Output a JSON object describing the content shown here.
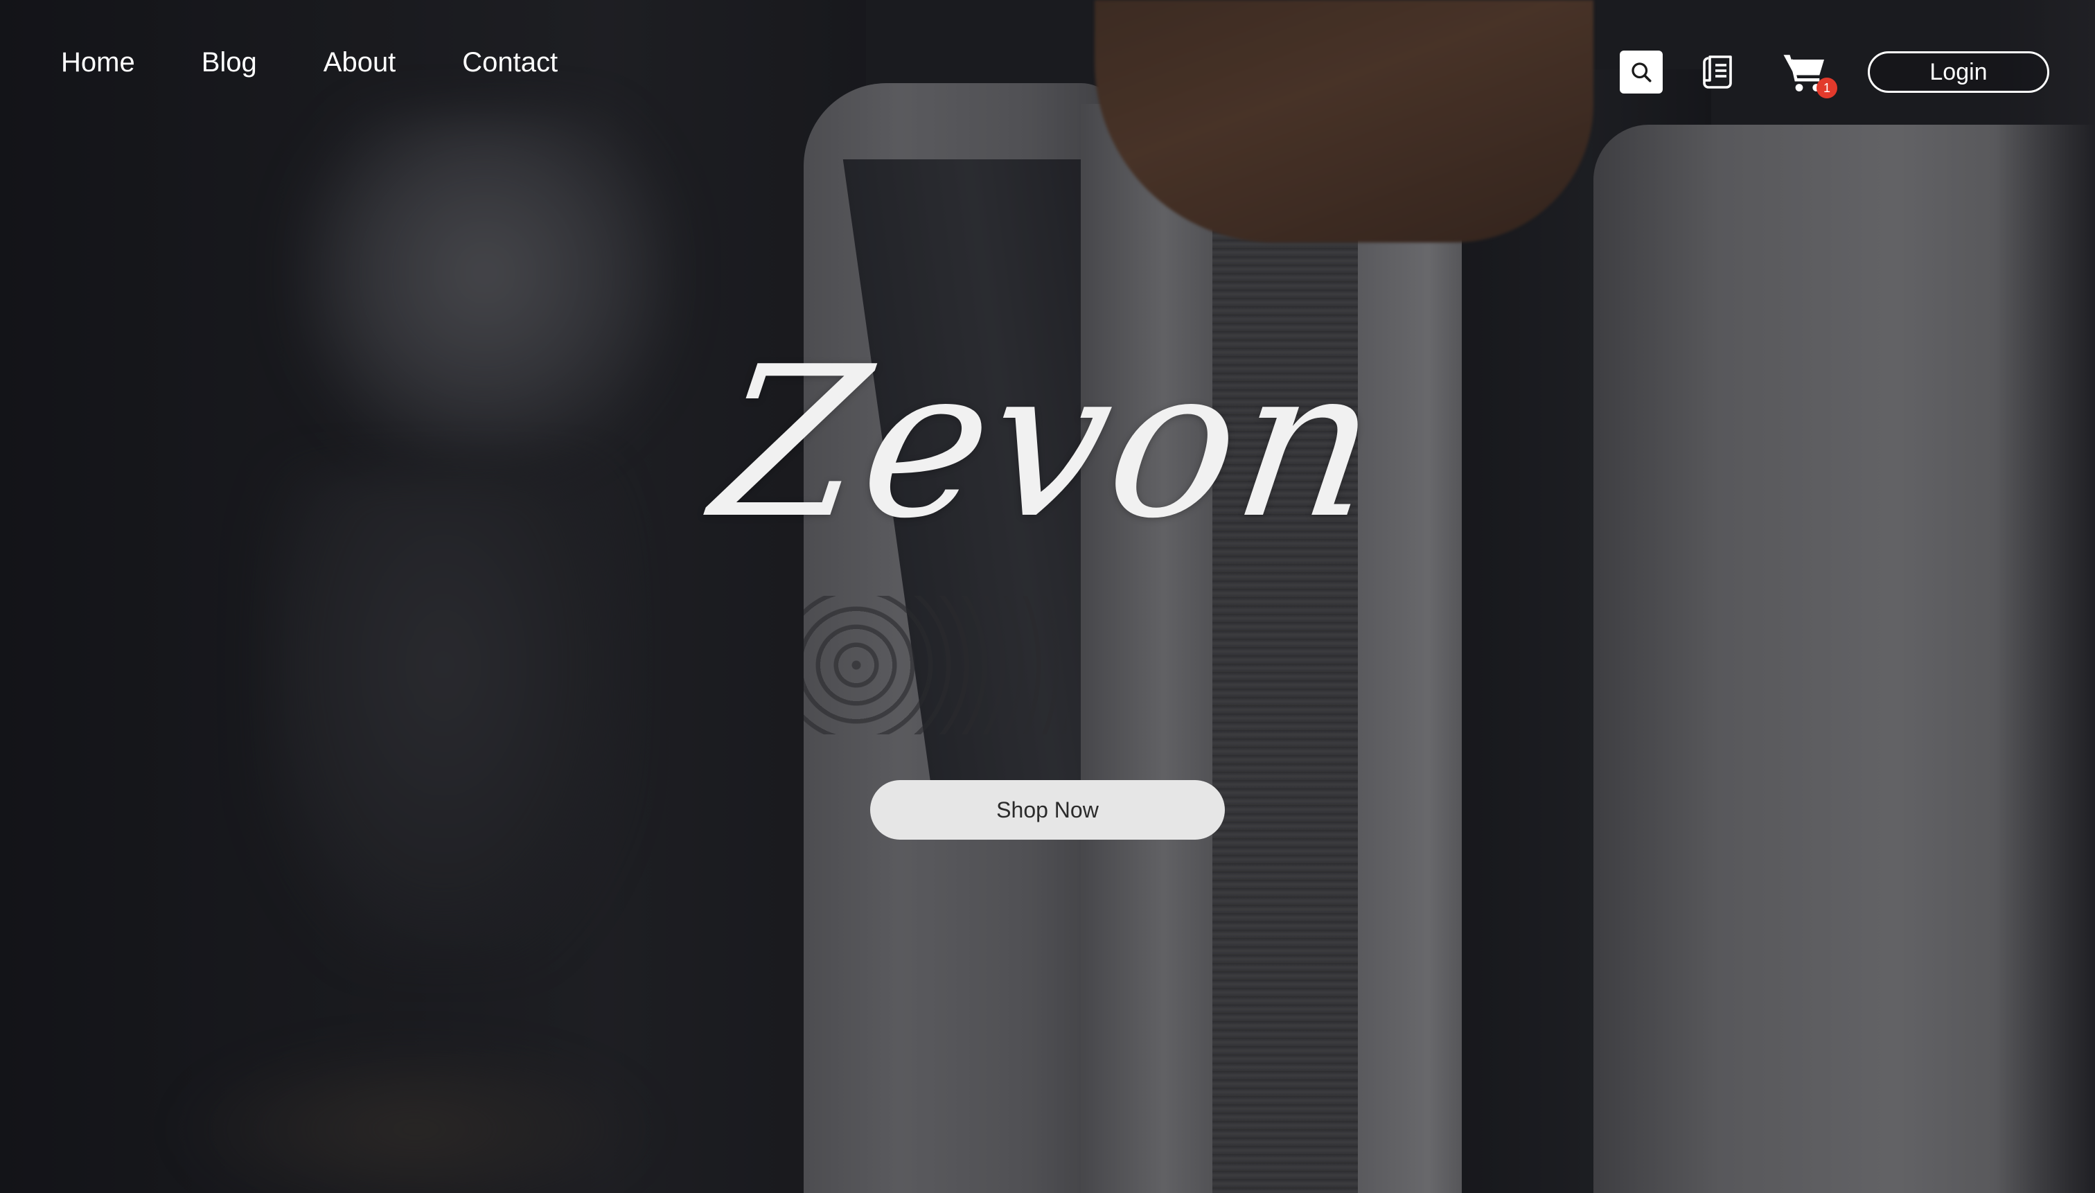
{
  "nav": {
    "items": [
      {
        "label": "Home"
      },
      {
        "label": "Blog"
      },
      {
        "label": "About"
      },
      {
        "label": "Contact"
      }
    ]
  },
  "actions": {
    "search_icon": "search-icon",
    "orders_icon": "receipt-icon",
    "cart_icon": "shopping-cart-icon",
    "cart_count": "1",
    "login_label": "Login"
  },
  "hero": {
    "brand": "Zevon",
    "cta_label": "Shop Now"
  },
  "colors": {
    "badge": "#e23a2c",
    "button_bg": "#e6e6e6",
    "text": "#ffffff"
  }
}
